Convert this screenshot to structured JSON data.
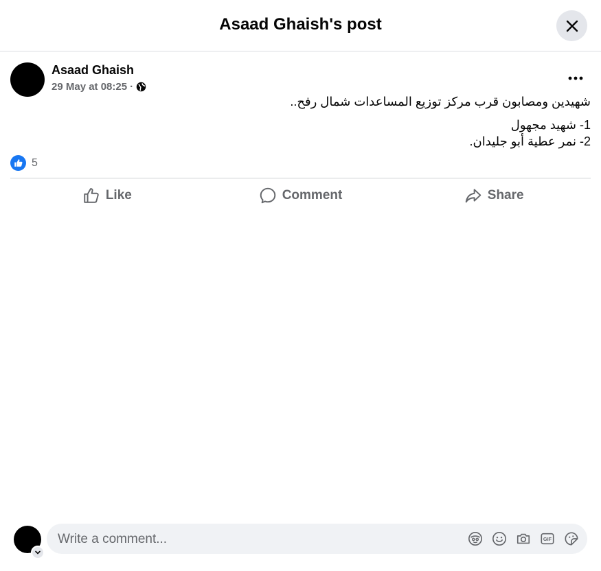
{
  "header": {
    "title": "Asaad Ghaish's post"
  },
  "post": {
    "author": "Asaad Ghaish",
    "timestamp": "29 May at 08:25",
    "separator": "·",
    "audience_icon": "globe-icon",
    "lines": [
      "شهيدين ومصابون قرب مركز توزيع المساعدات شمال رفح..",
      "1- شهيد مجهول",
      "2- نمر عطية أبو جليدان."
    ]
  },
  "reactions": {
    "icon": "like-icon",
    "count": "5",
    "color": "#1877f2"
  },
  "actions": [
    {
      "label": "Like",
      "icon": "thumbs-up-icon"
    },
    {
      "label": "Comment",
      "icon": "comment-bubble-icon"
    },
    {
      "label": "Share",
      "icon": "share-arrow-icon"
    }
  ],
  "composer": {
    "placeholder": "Write a comment...",
    "icons": [
      "avatar-sticker-icon",
      "emoji-icon",
      "camera-icon",
      "gif-icon",
      "sticker-icon"
    ]
  }
}
